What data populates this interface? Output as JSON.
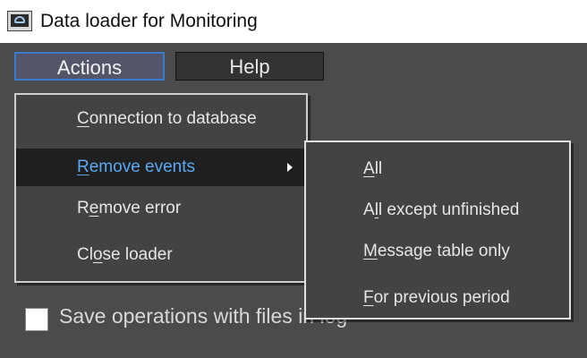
{
  "window": {
    "title": "Data loader for Monitoring",
    "icon": "monitor-eye-icon"
  },
  "menubar": {
    "actions": "Actions",
    "help": "Help"
  },
  "actions_menu": {
    "items": [
      {
        "pre": "",
        "mnemonic": "C",
        "post": "onnection to database"
      },
      {
        "pre": "",
        "mnemonic": "R",
        "post": "emove events",
        "highlighted": true,
        "has_submenu": true
      },
      {
        "pre": "R",
        "mnemonic": "e",
        "post": "move error"
      },
      {
        "pre": "Cl",
        "mnemonic": "o",
        "post": "se loader"
      }
    ]
  },
  "submenu": {
    "items": [
      {
        "pre": "",
        "mnemonic": "A",
        "post": "ll"
      },
      {
        "pre": "A",
        "mnemonic": "l",
        "post": "l except unfinished"
      },
      {
        "pre": "",
        "mnemonic": "M",
        "post": "essage table only"
      },
      {
        "pre": "",
        "mnemonic": "F",
        "post": "or previous period"
      }
    ]
  },
  "options": {
    "save_log_label": "Save operations with files in log",
    "save_log_checked": false
  },
  "colors": {
    "highlight_text": "#5aa9f5",
    "menu_bg": "#434343",
    "client_bg": "#4b4b4b",
    "active_border": "#3a7ad0"
  }
}
